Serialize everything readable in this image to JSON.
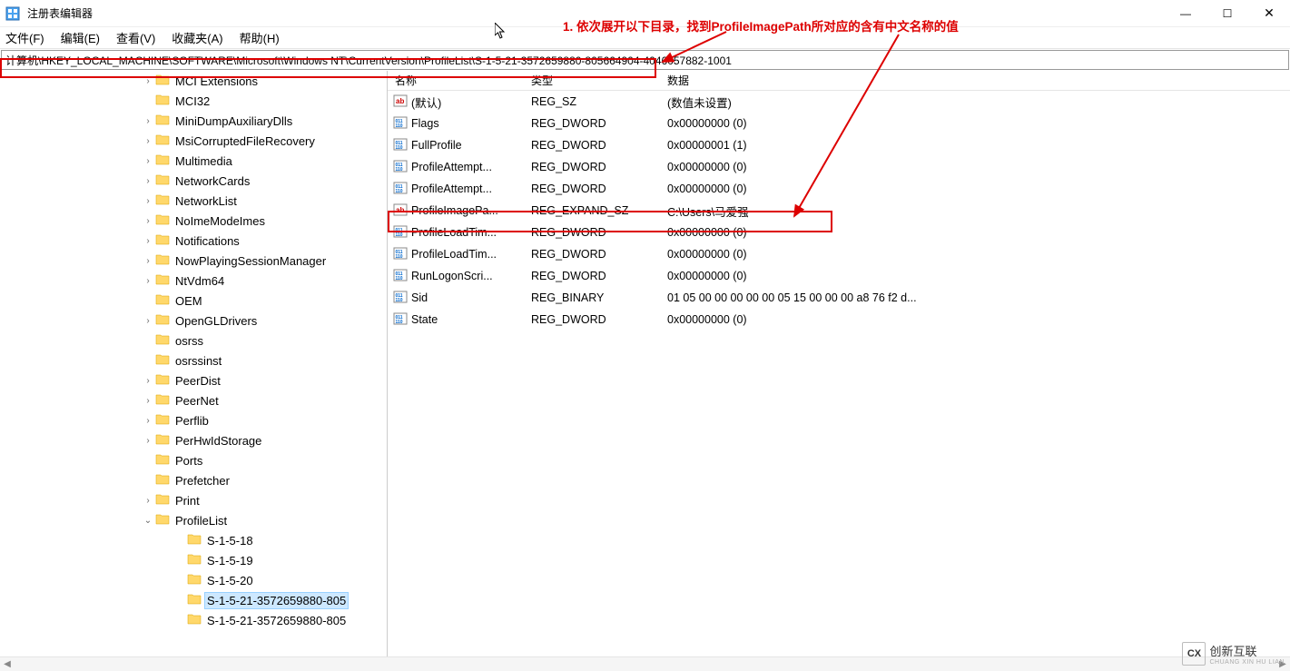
{
  "window": {
    "title": "注册表编辑器"
  },
  "menubar": {
    "file": "文件(F)",
    "edit": "编辑(E)",
    "view": "查看(V)",
    "favorites": "收藏夹(A)",
    "help": "帮助(H)"
  },
  "addressbar": {
    "path": "计算机\\HKEY_LOCAL_MACHINE\\SOFTWARE\\Microsoft\\Windows NT\\CurrentVersion\\ProfileList\\S-1-5-21-3572659880-805664904-4046057882-1001"
  },
  "annotation": {
    "text": "1. 依次展开以下目录，找到ProfileImagePath所对应的含有中文名称的值"
  },
  "tree": {
    "items": [
      {
        "label": "MCI Extensions",
        "indent": 155,
        "exp": ">"
      },
      {
        "label": "MCI32",
        "indent": 155,
        "exp": " "
      },
      {
        "label": "MiniDumpAuxiliaryDlls",
        "indent": 155,
        "exp": ">"
      },
      {
        "label": "MsiCorruptedFileRecovery",
        "indent": 155,
        "exp": ">"
      },
      {
        "label": "Multimedia",
        "indent": 155,
        "exp": ">"
      },
      {
        "label": "NetworkCards",
        "indent": 155,
        "exp": ">"
      },
      {
        "label": "NetworkList",
        "indent": 155,
        "exp": ">"
      },
      {
        "label": "NoImeModeImes",
        "indent": 155,
        "exp": ">"
      },
      {
        "label": "Notifications",
        "indent": 155,
        "exp": ">"
      },
      {
        "label": "NowPlayingSessionManager",
        "indent": 155,
        "exp": ">"
      },
      {
        "label": "NtVdm64",
        "indent": 155,
        "exp": ">"
      },
      {
        "label": "OEM",
        "indent": 155,
        "exp": " "
      },
      {
        "label": "OpenGLDrivers",
        "indent": 155,
        "exp": ">"
      },
      {
        "label": "osrss",
        "indent": 155,
        "exp": " "
      },
      {
        "label": "osrssinst",
        "indent": 155,
        "exp": " "
      },
      {
        "label": "PeerDist",
        "indent": 155,
        "exp": ">"
      },
      {
        "label": "PeerNet",
        "indent": 155,
        "exp": ">"
      },
      {
        "label": "Perflib",
        "indent": 155,
        "exp": ">"
      },
      {
        "label": "PerHwIdStorage",
        "indent": 155,
        "exp": ">"
      },
      {
        "label": "Ports",
        "indent": 155,
        "exp": " "
      },
      {
        "label": "Prefetcher",
        "indent": 155,
        "exp": " "
      },
      {
        "label": "Print",
        "indent": 155,
        "exp": ">"
      },
      {
        "label": "ProfileList",
        "indent": 155,
        "exp": "v"
      },
      {
        "label": "S-1-5-18",
        "indent": 190,
        "exp": " "
      },
      {
        "label": "S-1-5-19",
        "indent": 190,
        "exp": " "
      },
      {
        "label": "S-1-5-20",
        "indent": 190,
        "exp": " "
      },
      {
        "label": "S-1-5-21-3572659880-805",
        "indent": 190,
        "exp": " ",
        "selected": true
      },
      {
        "label": "S-1-5-21-3572659880-805",
        "indent": 190,
        "exp": " "
      }
    ]
  },
  "list": {
    "headers": {
      "name": "名称",
      "type": "类型",
      "data": "数据"
    },
    "rows": [
      {
        "name": "(默认)",
        "type": "REG_SZ",
        "data": "(数值未设置)",
        "icon": "str"
      },
      {
        "name": "Flags",
        "type": "REG_DWORD",
        "data": "0x00000000 (0)",
        "icon": "bin"
      },
      {
        "name": "FullProfile",
        "type": "REG_DWORD",
        "data": "0x00000001 (1)",
        "icon": "bin"
      },
      {
        "name": "ProfileAttempt...",
        "type": "REG_DWORD",
        "data": "0x00000000 (0)",
        "icon": "bin"
      },
      {
        "name": "ProfileAttempt...",
        "type": "REG_DWORD",
        "data": "0x00000000 (0)",
        "icon": "bin"
      },
      {
        "name": "ProfileImagePa...",
        "type": "REG_EXPAND_SZ",
        "data": "C:\\Users\\马爱强",
        "icon": "str",
        "highlighted": true
      },
      {
        "name": "ProfileLoadTim...",
        "type": "REG_DWORD",
        "data": "0x00000000 (0)",
        "icon": "bin"
      },
      {
        "name": "ProfileLoadTim...",
        "type": "REG_DWORD",
        "data": "0x00000000 (0)",
        "icon": "bin"
      },
      {
        "name": "RunLogonScri...",
        "type": "REG_DWORD",
        "data": "0x00000000 (0)",
        "icon": "bin"
      },
      {
        "name": "Sid",
        "type": "REG_BINARY",
        "data": "01 05 00 00 00 00 00 05 15 00 00 00 a8 76 f2 d...",
        "icon": "bin"
      },
      {
        "name": "State",
        "type": "REG_DWORD",
        "data": "0x00000000 (0)",
        "icon": "bin"
      }
    ]
  },
  "watermark": {
    "text": "创新互联",
    "sub": "CHUANG XIN HU LIAN"
  }
}
